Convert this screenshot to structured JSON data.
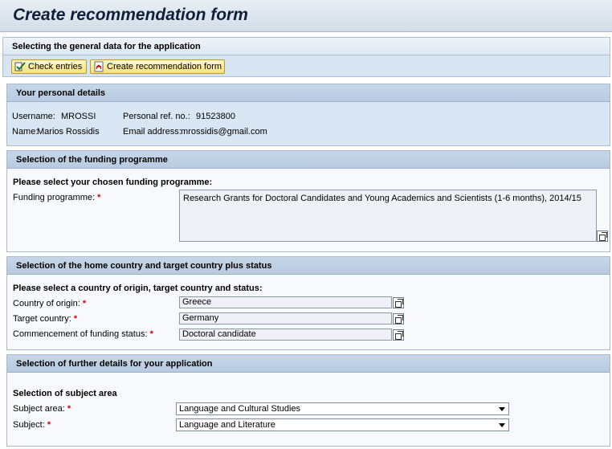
{
  "page": {
    "title": "Create recommendation form"
  },
  "general": {
    "heading": "Selecting the general data for the application",
    "check_entries_label": "Check entries",
    "create_form_label": "Create recommendation form"
  },
  "personal": {
    "heading": "Your personal details",
    "username_label": "Username:",
    "username_value": "MROSSI",
    "name_label": "Name:",
    "name_value": "Marios Rossidis",
    "ref_label": "Personal ref. no.:",
    "ref_value": "91523800",
    "email_label": "Email address:",
    "email_value": "mrossidis@gmail.com"
  },
  "funding": {
    "heading": "Selection of the funding programme",
    "prompt": "Please select your chosen funding programme:",
    "programme_label": "Funding programme:",
    "programme_value": "Research Grants for Doctoral Candidates and Young Academics and Scientists (1-6 months), 2014/15"
  },
  "country": {
    "heading": "Selection of the home country and target country plus status",
    "prompt": "Please select a country of origin, target country and status:",
    "origin_label": "Country of origin:",
    "origin_value": "Greece",
    "target_label": "Target country:",
    "target_value": "Germany",
    "status_label": "Commencement of funding status:",
    "status_value": "Doctoral candidate"
  },
  "details": {
    "heading": "Selection of further details for your application",
    "subheading": "Selection of subject area",
    "area_label": "Subject area:",
    "area_value": "Language and Cultural Studies",
    "subject_label": "Subject:",
    "subject_value": "Language and Literature"
  },
  "required_marker": "*",
  "icons": {
    "check": "check-entries-icon",
    "form": "pdf-form-icon",
    "valuehelp": "value-help-icon",
    "dropdown": "chevron-down-icon"
  }
}
